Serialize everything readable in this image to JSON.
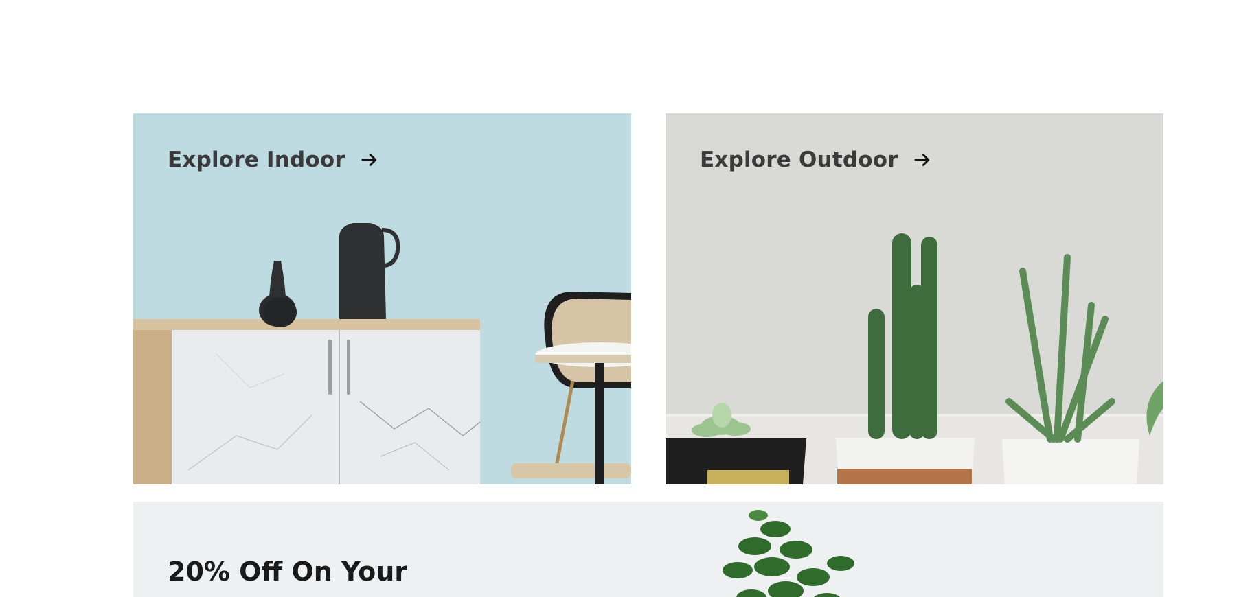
{
  "cards": {
    "indoor": {
      "label": "Explore Indoor",
      "icon": "arrow-right-icon"
    },
    "outdoor": {
      "label": "Explore Outdoor",
      "icon": "arrow-right-icon"
    }
  },
  "promo": {
    "heading": "20% Off On Your"
  },
  "colors": {
    "indoor_bg": "#bddbe1",
    "outdoor_bg": "#d9dad6",
    "promo_bg": "#eef0f1",
    "text": "#3a3a3a"
  }
}
